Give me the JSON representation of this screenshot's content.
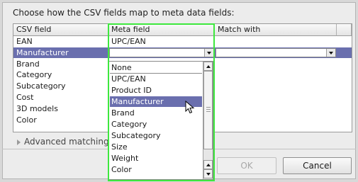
{
  "instructions": "Choose how the CSV fields map to meta data fields:",
  "columns": [
    "CSV field",
    "Meta field",
    "Match with"
  ],
  "rows": [
    {
      "csv": "EAN",
      "meta": "UPC/EAN",
      "match": ""
    },
    {
      "csv": "Manufacturer",
      "meta": "",
      "match": ""
    },
    {
      "csv": "Brand",
      "meta": "",
      "match": ""
    },
    {
      "csv": "Category",
      "meta": "",
      "match": ""
    },
    {
      "csv": "Subcategory",
      "meta": "",
      "match": ""
    },
    {
      "csv": "Cost",
      "meta": "",
      "match": ""
    },
    {
      "csv": "3D models",
      "meta": "",
      "match": ""
    },
    {
      "csv": "Color",
      "meta": "",
      "match": ""
    }
  ],
  "dropdown": {
    "options": [
      "None",
      "UPC/EAN",
      "Product ID",
      "Manufacturer",
      "Brand",
      "Category",
      "Subcategory",
      "Size",
      "Weight",
      "Color"
    ],
    "selected": "Manufacturer"
  },
  "advanced_label": "Advanced matching",
  "buttons": {
    "ok": "OK",
    "cancel": "Cancel"
  },
  "colors": {
    "selection": "#6a6fae",
    "highlight": "#3ee83e"
  },
  "icons": {
    "cursor": "pointer-cursor-icon",
    "expander": "triangle-right-icon"
  }
}
